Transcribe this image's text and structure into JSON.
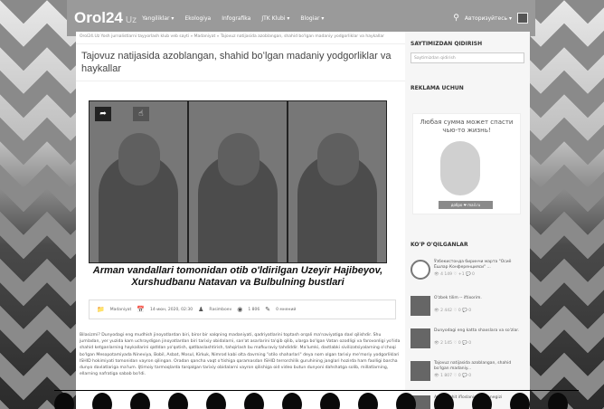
{
  "nav": {
    "logo": "Orol24",
    "logo_suffix": "Uz",
    "menu": [
      "Yangiliklar ▾",
      "Ekologiya",
      "Infografika",
      "JTK Klubi ▾",
      "Blogiar ▾"
    ],
    "login": "Авторизуйтесь ▾"
  },
  "article": {
    "breadcrumb": "Orol24.Uz Yosh jurnalistlarni tayyorlash klub veb sayti » Madaniyat » Tajovuz natijasida azoblangan, shahid bo'lgan madaniy yodgorliklar va haykallar",
    "title": "Tajovuz natijasida azoblangan, shahid boʻlgan madaniy yodgorliklar va haykallar",
    "caption": "Arman vandallari tomonidan otib o'ldirilgan Uzeyir Hajibeyov, Xurshudbanu Natavan va Bulbulning bustlari",
    "meta": {
      "category": "Madaniyat",
      "date": "14-июн, 2020, 02:30",
      "author": "Rasimboev",
      "views": "1 806",
      "comments": "0 мнений"
    },
    "body": "Bilasizmi? Dunyodagi eng mudhish jinoyatlardan biri, biror bir xalqning madaniyati, qadriyatlarini toptash orqali ma'naviyatiga daxl qilishdir. Shu jumladan, yer yuzida kam uchraydigan jinoyatlardan biri tarixiy obidalarni, san'at asarlarini ta'qib qilib, ularga bo'lgan Vatan ozodligi va farovonligi yo'lida shahid ketganlarning haykallarini qatldan yo'qotish, qatlbaslashtirish, tahqirlash bu mafkuraviy tahdiddir. Ma'lumki, dastlabki sivilizatsiyalarning o'choqi bo'lgan Mesopotamiyada Nineviya, Bobil, Asbat, Mosul, Kirkuk, Nimrod kabi olta davrning \"otilo shaharlari\" deya nom olgan tarixiy me'moriy yodgorliklari ISHID hokimiyati tomonidan vayron qilingan. Oradan qancha vaqt o'tishiga qaramasdan ISHID terrorchilik guruhining janglari hozirda ham faolligi barcha dunyo davlatlariga ma'lum. Ijtimoiy tarmoqlarda tarqalgan tarixiy obidalarni vayron qilishiga oid video butun dunyoni dahshatga solib, millatlarning, ellarning nafratiga sabab bo'ldi."
  },
  "sidebar": {
    "search_heading": "SAYTIMIZDAN QIDIRISH",
    "search_placeholder": "Saytimizdan qidirish",
    "ads_heading": "REKLAMA UCHUN",
    "ad_text": "Любая сумма может спасти чью-то жизнь!",
    "ad_logo": "добро ❤ mail.ru",
    "popular_heading": "KO'P O'QILGANLAR",
    "popular": [
      {
        "title": "Ўзбекистонда биринчи марта \"Осиё Ёшлар Конференцияси\" ...",
        "stats": "👁 4 149  ♡ +1  💬 0"
      },
      {
        "title": "O'zbek tilim -- iftixorim.",
        "stats": "👁 2 442  ♡ 0  💬 0"
      },
      {
        "title": "Dunyodagi eng katta shaxslara va so'zlar.",
        "stats": "👁 2 145  ♡ 0  💬 0"
      },
      {
        "title": "Tajovuz natijasida azoblangan, shahid bo'lgan madaniy...",
        "stats": "👁 1 807  ♡ 0  💬 0"
      },
      {
        "title": "Atraf-muhit ifloslanishining negizi",
        "stats": ""
      }
    ]
  },
  "colors": {
    "nav": "#9a9a9a",
    "page": "#ffffff",
    "sidebar": "#f6f6f6"
  },
  "icons": [
    "search-icon",
    "folder-icon",
    "calendar-icon",
    "user-icon",
    "eye-icon",
    "comment-icon",
    "share-icon",
    "thumb-up-icon"
  ]
}
